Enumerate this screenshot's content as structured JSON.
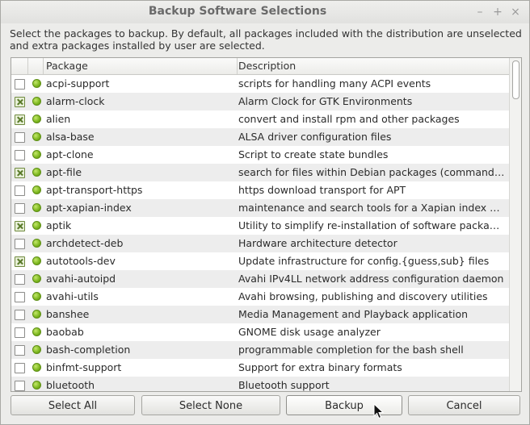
{
  "window": {
    "title": "Backup Software Selections"
  },
  "titlebar_buttons": {
    "minimize": "–",
    "maximize": "+",
    "close": "×"
  },
  "intro": "Select the packages to backup. By default, all packages included with the distribution are unselected and extra packages installed by user are selected.",
  "columns": {
    "package": "Package",
    "description": "Description"
  },
  "rows": [
    {
      "checked": false,
      "package": "acpi-support",
      "description": "scripts for handling many ACPI events"
    },
    {
      "checked": true,
      "package": "alarm-clock",
      "description": "Alarm Clock for GTK Environments"
    },
    {
      "checked": true,
      "package": "alien",
      "description": "convert and install rpm and other packages"
    },
    {
      "checked": false,
      "package": "alsa-base",
      "description": "ALSA driver configuration files"
    },
    {
      "checked": false,
      "package": "apt-clone",
      "description": "Script to create state bundles"
    },
    {
      "checked": true,
      "package": "apt-file",
      "description": "search for files within Debian packages (command-li…"
    },
    {
      "checked": false,
      "package": "apt-transport-https",
      "description": "https download transport for APT"
    },
    {
      "checked": false,
      "package": "apt-xapian-index",
      "description": "maintenance and search tools for a Xapian index of …"
    },
    {
      "checked": true,
      "package": "aptik",
      "description": "Utility to simplify re-installation of software packages"
    },
    {
      "checked": false,
      "package": "archdetect-deb",
      "description": "Hardware architecture detector"
    },
    {
      "checked": true,
      "package": "autotools-dev",
      "description": "Update infrastructure for config.{guess,sub} files"
    },
    {
      "checked": false,
      "package": "avahi-autoipd",
      "description": "Avahi IPv4LL network address configuration daemon"
    },
    {
      "checked": false,
      "package": "avahi-utils",
      "description": "Avahi browsing, publishing and discovery utilities"
    },
    {
      "checked": false,
      "package": "banshee",
      "description": "Media Management and Playback application"
    },
    {
      "checked": false,
      "package": "baobab",
      "description": "GNOME disk usage analyzer"
    },
    {
      "checked": false,
      "package": "bash-completion",
      "description": "programmable completion for the bash shell"
    },
    {
      "checked": false,
      "package": "binfmt-support",
      "description": "Support for extra binary formats"
    },
    {
      "checked": false,
      "package": "bluetooth",
      "description": "Bluetooth support"
    }
  ],
  "buttons": {
    "select_all": "Select All",
    "select_none": "Select None",
    "backup": "Backup",
    "cancel": "Cancel"
  },
  "status_icon": "green-dot-icon",
  "colors": {
    "checked_mark": "#5a7a2a",
    "status_dot": "#7ab51d"
  }
}
